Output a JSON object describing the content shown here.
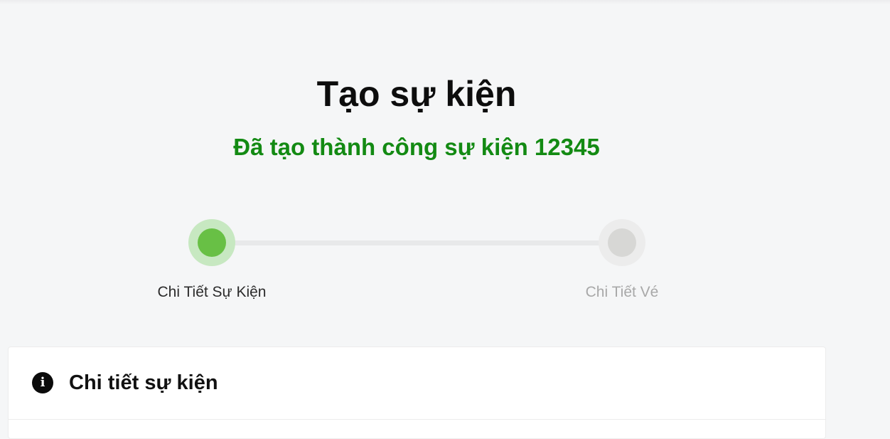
{
  "page": {
    "title": "Tạo sự kiện",
    "success_message": "Đã tạo thành công sự kiện 12345"
  },
  "stepper": {
    "steps": [
      {
        "label": "Chi Tiết Sự Kiện",
        "state": "active"
      },
      {
        "label": "Chi Tiết Vé",
        "state": "inactive"
      }
    ],
    "current_step": 1,
    "total_steps": 2
  },
  "card": {
    "icon": "info-icon",
    "title": "Chi tiết sự kiện"
  },
  "colors": {
    "background": "#f5f6f7",
    "success": "#138a13",
    "step_active": "#68c045",
    "step_active_halo": "#c7e8c1",
    "step_inactive": "#d7d7d5",
    "step_inactive_label": "#a8a8a8"
  }
}
